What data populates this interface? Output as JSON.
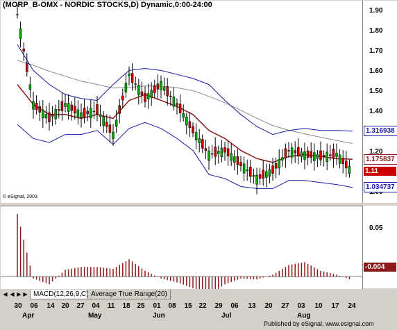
{
  "title": "(MORP_B-OMX - NORDIC STOCKS,D) Dynamic,0:00-24:00",
  "copyright": "© eSignal, 2003",
  "price_axis": {
    "ticks": [
      "1.90",
      "1.80",
      "1.70",
      "1.60",
      "1.50",
      "1.40",
      "1.20",
      "1.00"
    ],
    "labels": {
      "upper_band": "1.316938",
      "middle_band": "1.175837",
      "last_price": "1.11",
      "lower_band": "1.034737"
    }
  },
  "macd_axis": {
    "ticks": [
      "0.05",
      "0.00"
    ],
    "last_value": "-0.004"
  },
  "tabs": [
    {
      "label": "MACD(12,26,9,C)",
      "active": true
    },
    {
      "label": "Average True Range(20)",
      "active": false
    }
  ],
  "date_axis": {
    "days": [
      "30",
      "06",
      "14",
      "20",
      "27",
      "04",
      "11",
      "18",
      "25",
      "01",
      "08",
      "15",
      "22",
      "29",
      "06",
      "13",
      "20",
      "27",
      "03",
      "10",
      "17",
      "24"
    ],
    "months": [
      "Apr",
      "May",
      "Jun",
      "Jul",
      "Aug"
    ]
  },
  "footer": "Published by eSignal, www.esignal.com",
  "colors": {
    "up_candle": "#00aa00",
    "down_candle": "#cc0000",
    "bollinger": "#1a1aaa",
    "middle_ma": "#8b1a1a",
    "long_ma": "#8c8c8c",
    "macd_hist": "#8b1a1a",
    "upper_label_bg": "#ffffff",
    "middle_label_bg": "#ffffff",
    "last_label_bg": "#cc0000"
  },
  "chart_data": [
    {
      "type": "candlestick",
      "title": "(MORP_B-OMX - NORDIC STOCKS,D) Dynamic,0:00-24:00",
      "ylim": [
        1.0,
        1.92
      ],
      "x": [
        "30 Mar",
        "06 Apr",
        "14 Apr",
        "20 Apr",
        "27 Apr",
        "04 May",
        "11 May",
        "18 May",
        "25 May",
        "01 Jun",
        "08 Jun",
        "15 Jun",
        "22 Jun",
        "29 Jun",
        "06 Jul",
        "13 Jul",
        "20 Jul",
        "27 Jul",
        "03 Aug",
        "10 Aug",
        "17 Aug",
        "24 Aug"
      ],
      "close": [
        1.9,
        1.45,
        1.38,
        1.45,
        1.4,
        1.42,
        1.3,
        1.6,
        1.48,
        1.55,
        1.45,
        1.32,
        1.2,
        1.22,
        1.15,
        1.08,
        1.12,
        1.22,
        1.2,
        1.19,
        1.2,
        1.11
      ],
      "series": [
        {
          "name": "upper_band",
          "values": [
            1.75,
            1.62,
            1.55,
            1.5,
            1.48,
            1.47,
            1.55,
            1.62,
            1.63,
            1.62,
            1.6,
            1.58,
            1.55,
            1.47,
            1.4,
            1.34,
            1.3,
            1.32,
            1.33,
            1.32,
            1.32,
            1.317
          ]
        },
        {
          "name": "middle_band",
          "values": [
            1.55,
            1.45,
            1.4,
            1.4,
            1.38,
            1.4,
            1.38,
            1.47,
            1.5,
            1.47,
            1.44,
            1.4,
            1.32,
            1.28,
            1.22,
            1.18,
            1.16,
            1.19,
            1.2,
            1.19,
            1.18,
            1.176
          ]
        },
        {
          "name": "lower_band",
          "values": [
            1.35,
            1.28,
            1.26,
            1.3,
            1.3,
            1.32,
            1.25,
            1.33,
            1.36,
            1.33,
            1.28,
            1.22,
            1.1,
            1.08,
            1.04,
            1.03,
            1.03,
            1.07,
            1.07,
            1.06,
            1.05,
            1.035
          ]
        }
      ]
    },
    {
      "type": "bar",
      "title": "MACD(12,26,9,C)",
      "ylim": [
        -0.01,
        0.07
      ],
      "x": [
        "30 Mar",
        "06 Apr",
        "14 Apr",
        "20 Apr",
        "27 Apr",
        "04 May",
        "11 May",
        "18 May",
        "25 May",
        "01 Jun",
        "08 Jun",
        "15 Jun",
        "22 Jun",
        "29 Jun",
        "06 Jul",
        "13 Jul",
        "20 Jul",
        "27 Jul",
        "03 Aug",
        "10 Aug",
        "17 Aug",
        "24 Aug"
      ],
      "values": [
        0.065,
        -0.002,
        -0.008,
        0.007,
        0.01,
        0.01,
        0.008,
        0.018,
        0.006,
        -0.002,
        -0.006,
        -0.012,
        -0.02,
        -0.008,
        -0.002,
        -0.003,
        0.002,
        0.012,
        0.015,
        0.006,
        0.002,
        -0.004
      ]
    }
  ]
}
